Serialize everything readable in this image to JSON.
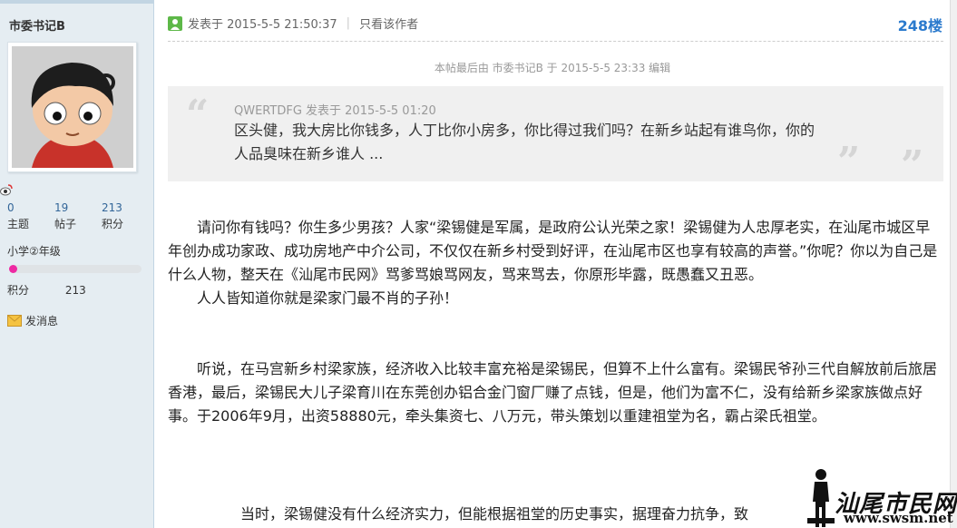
{
  "author": {
    "name": "市委书记B",
    "stats": [
      {
        "value": "0",
        "label": "主题"
      },
      {
        "value": "19",
        "label": "帖子"
      },
      {
        "value": "213",
        "label": "积分"
      }
    ],
    "level": "小学②年级",
    "level_progress": 0.06,
    "credit_label": "积分",
    "credit_value": "213",
    "send_message": "发消息"
  },
  "post": {
    "posted_at": "发表于 2015-5-5 21:50:37",
    "only_author": "只看该作者",
    "floor": "248楼",
    "edited_note": "本帖最后由 市委书记B 于 2015-5-5 23:33 编辑",
    "quote": {
      "author_line": "QWERTDFG 发表于 2015-5-5 01:20",
      "text": "区头健，我大房比你钱多，人丁比你小房多，你比得过我们吗？在新乡站起有谁鸟你，你的人品臭味在新乡谁人 ..."
    },
    "paragraphs": [
      "请问你有钱吗？你生多少男孩？人家“梁锡健是军属，是政府公认光荣之家！梁锡健为人忠厚老实，在汕尾市城区早年创办成功家政、成功房地产中介公司，不仅仅在新乡村受到好评，在汕尾市区也享有较高的声誉。”你呢？你以为自己是什么人物，整天在《汕尾市民网》骂爹骂娘骂网友，骂来骂去，你原形毕露，既愚蠢又丑恶。",
      "人人皆知道你就是梁家门最不肖的子孙！",
      "听说，在马宫新乡村梁家族，经济收入比较丰富充裕是梁锡民，但算不上什么富有。梁锡民爷孙三代自解放前后旅居香港，最后，梁锡民大儿子梁育川在东莞创办铝合金门窗厂赚了点钱，但是，他们为富不仁，没有给新乡梁家族做点好事。于2006年9月，出资58880元，牵头集资七、八万元，带头策划以重建祖堂为名，霸占梁氏祖堂。",
      "当时，梁锡健没有什么经济实力，但能根据祖堂的历史事实，据理奋力抗争，致"
    ]
  },
  "watermark": {
    "text": "汕尾市民网",
    "url": "www.swsm.net"
  },
  "colors": {
    "sidebar_bg": "#e5edf2",
    "floor_blue": "#2b7acd",
    "progress_pink": "#ee2aa3",
    "online_green": "#5db848"
  }
}
